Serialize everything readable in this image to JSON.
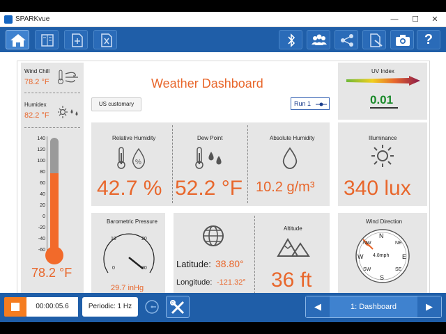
{
  "window": {
    "title": "SPARKvue",
    "minimize": "—",
    "maximize": "☐",
    "close": "✕"
  },
  "toolbar": {
    "icons": [
      "home-icon",
      "journal-icon",
      "add-page-icon",
      "excel-icon",
      "bluetooth-icon",
      "group-icon",
      "share-icon",
      "export-icon",
      "camera-icon",
      "help-icon"
    ],
    "help_label": "?"
  },
  "dashboard": {
    "title": "Weather Dashboard",
    "units_button": "US customary",
    "run_label": "Run 1",
    "left": {
      "wind_chill_label": "Wind Chill",
      "wind_chill_value": "78.2 °F",
      "humidex_label": "Humidex",
      "humidex_value": "82.2 °F",
      "thermo_ticks": [
        "140",
        "120",
        "100",
        "80",
        "60",
        "40",
        "20",
        "0",
        "-20",
        "-40",
        "-60"
      ],
      "temperature_value": "78.2 °F",
      "temperature_fraction": 0.69
    },
    "cards": {
      "rh_label": "Relative Humidity",
      "rh_value": "42.7 %",
      "dew_label": "Dew Point",
      "dew_value": "52.2 °F",
      "abs_label": "Absolute Humidity",
      "abs_value": "10.2 g/m³",
      "baro_label": "Barometric Pressure",
      "baro_ticks": [
        "0",
        "10",
        "20",
        "30"
      ],
      "baro_value": "29.7 inHg",
      "lat_label": "Latitude:",
      "lat_value": "38.80°",
      "lon_label": "Longitude:",
      "lon_value": "-121.32°",
      "alt_label": "Altitude",
      "alt_value": "36 ft"
    },
    "right": {
      "uv_label": "UV Index",
      "uv_value": "0.01",
      "illum_label": "Illuminance",
      "illum_value": "340 lux",
      "wind_label": "Wind Direction",
      "wind_speed": "4.8mph",
      "compass": {
        "n": "N",
        "ne": "NE",
        "e": "E",
        "se": "SE",
        "s": "S",
        "sw": "SW",
        "w": "W",
        "nw": "NW"
      }
    }
  },
  "bottombar": {
    "timer": "00:00:05.6",
    "sampling": "Periodic: 1 Hz",
    "page_label": "1: Dashboard"
  },
  "colors": {
    "accent": "#1f5ea8",
    "orange": "#e8672c",
    "stop": "#f57c1f"
  }
}
